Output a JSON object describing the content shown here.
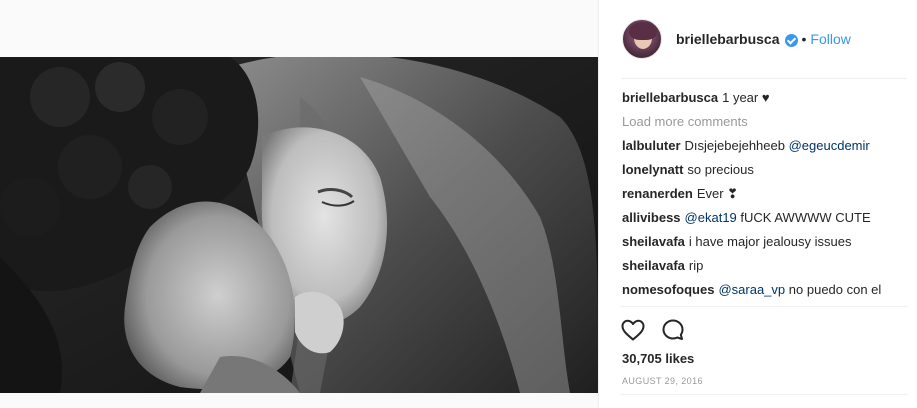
{
  "post": {
    "photo_alt": "",
    "author": "briellebarbusca",
    "verified": true,
    "follow_label": "Follow",
    "separator": "•",
    "caption_user": "briellebarbusca",
    "caption_text": "1 year",
    "caption_heart": "♥",
    "load_more": "Load more comments",
    "comments": [
      {
        "user": "lalbuluter",
        "mention": "",
        "text": "Dısjejebejehheeb",
        "mention_after": "@egeucdemir"
      },
      {
        "user": "lonelynatt",
        "mention": "",
        "text": "so precious",
        "mention_after": ""
      },
      {
        "user": "renanerden",
        "mention": "",
        "text": "Ever ❣",
        "mention_after": ""
      },
      {
        "user": "allivibess",
        "mention": "@ekat19",
        "text": "fUCK AWWWW CUTE",
        "mention_after": ""
      },
      {
        "user": "sheilavafa",
        "mention": "",
        "text": "i have major jealousy issues",
        "mention_after": ""
      },
      {
        "user": "sheilavafa",
        "mention": "",
        "text": "rip",
        "mention_after": ""
      },
      {
        "user": "nomesofoques",
        "mention": "@saraa_vp",
        "text": "no puedo con el",
        "mention_after": ""
      }
    ],
    "likes": "30,705 likes",
    "date": "AUGUST 29, 2016",
    "icons": {
      "like": "heart-outline-icon",
      "comment": "speech-bubble-icon",
      "verified": "verified-badge-icon"
    },
    "colors": {
      "link": "#3897f0",
      "mention": "#003569",
      "muted": "#999999",
      "text": "#262626"
    }
  }
}
